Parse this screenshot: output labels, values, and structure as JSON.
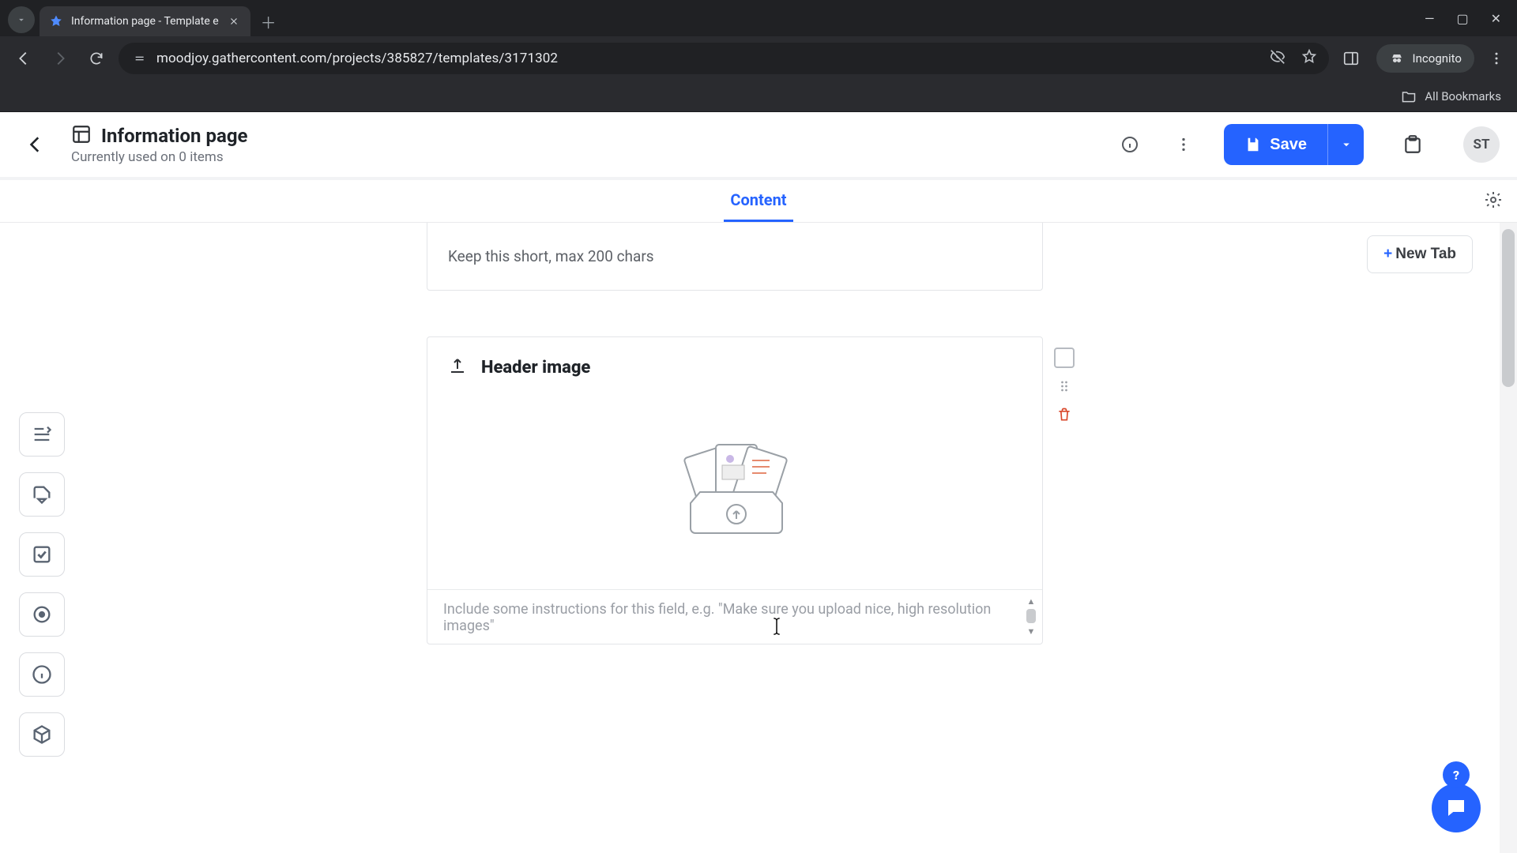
{
  "browser": {
    "tab_title": "Information page - Template e",
    "url": "moodjoy.gathercontent.com/projects/385827/templates/3171302",
    "incognito_label": "Incognito",
    "all_bookmarks": "All Bookmarks"
  },
  "header": {
    "title": "Information page",
    "subtitle": "Currently used on 0 items",
    "save_label": "Save",
    "avatar_initials": "ST"
  },
  "tabs": {
    "content_label": "Content",
    "new_tab_label": "New Tab"
  },
  "fields": {
    "hint_text": "Keep this short, max 200 chars",
    "upload_title": "Header image",
    "upload_instructions_placeholder": "Include some instructions for this field, e.g. \"Make sure you upload nice, high resolution images\""
  },
  "help": {
    "question": "?"
  }
}
